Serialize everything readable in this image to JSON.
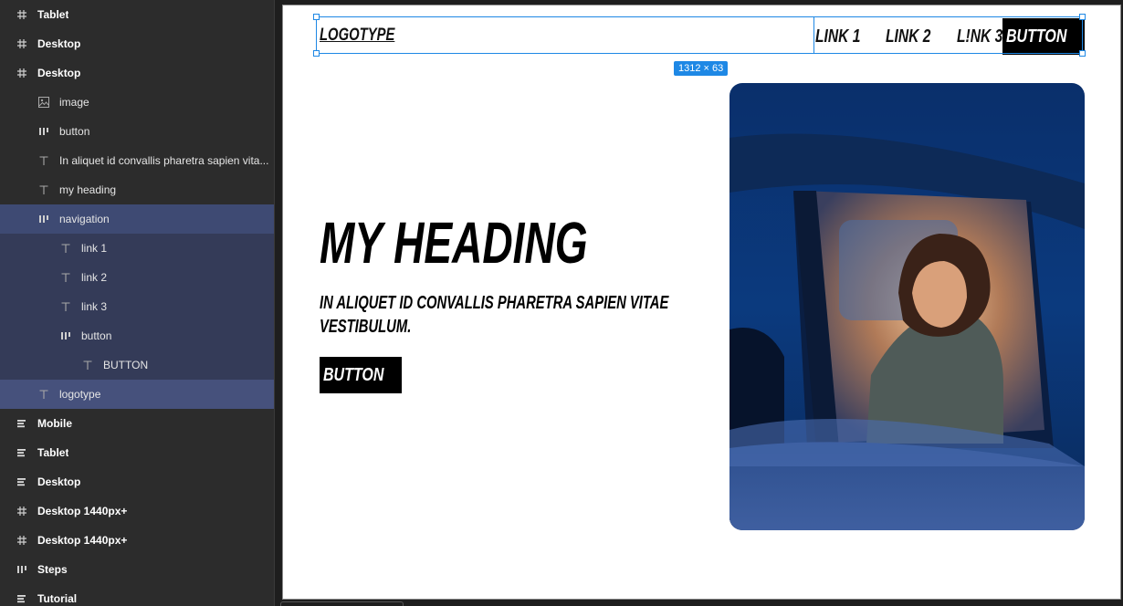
{
  "layers": [
    {
      "label": "Tablet",
      "icon": "frame-icon",
      "depth": 0,
      "bold": true,
      "state": ""
    },
    {
      "label": "Desktop",
      "icon": "frame-icon",
      "depth": 0,
      "bold": true,
      "state": ""
    },
    {
      "label": "Desktop",
      "icon": "frame-icon",
      "depth": 0,
      "bold": true,
      "state": ""
    },
    {
      "label": "image",
      "icon": "image-icon",
      "depth": 1,
      "bold": false,
      "state": ""
    },
    {
      "label": "button",
      "icon": "auto-layout-icon",
      "depth": 1,
      "bold": false,
      "state": ""
    },
    {
      "label": "In aliquet id convallis pharetra sapien vita...",
      "icon": "text-icon",
      "depth": 1,
      "bold": false,
      "state": ""
    },
    {
      "label": "my heading",
      "icon": "text-icon",
      "depth": 1,
      "bold": false,
      "state": ""
    },
    {
      "label": "navigation",
      "icon": "auto-layout-icon",
      "depth": 1,
      "bold": false,
      "state": "sel-parent"
    },
    {
      "label": "link 1",
      "icon": "text-icon",
      "depth": 2,
      "bold": false,
      "state": "sel-child"
    },
    {
      "label": "link 2",
      "icon": "text-icon",
      "depth": 2,
      "bold": false,
      "state": "sel-child"
    },
    {
      "label": "link 3",
      "icon": "text-icon",
      "depth": 2,
      "bold": false,
      "state": "sel-child"
    },
    {
      "label": "button",
      "icon": "auto-layout-icon",
      "depth": 2,
      "bold": false,
      "state": "sel-child"
    },
    {
      "label": "BUTTON",
      "icon": "text-icon",
      "depth": 3,
      "bold": false,
      "state": "sel-child"
    },
    {
      "label": "logotype",
      "icon": "text-icon",
      "depth": 1,
      "bold": false,
      "state": "sel-direct"
    },
    {
      "label": "Mobile",
      "icon": "list-icon",
      "depth": 0,
      "bold": true,
      "state": ""
    },
    {
      "label": "Tablet",
      "icon": "list-icon",
      "depth": 0,
      "bold": true,
      "state": ""
    },
    {
      "label": "Desktop",
      "icon": "list-icon",
      "depth": 0,
      "bold": true,
      "state": ""
    },
    {
      "label": "Desktop 1440px+",
      "icon": "frame-icon",
      "depth": 0,
      "bold": true,
      "state": ""
    },
    {
      "label": "Desktop 1440px+",
      "icon": "frame-icon",
      "depth": 0,
      "bold": true,
      "state": ""
    },
    {
      "label": "Steps",
      "icon": "auto-layout-icon",
      "depth": 0,
      "bold": true,
      "state": ""
    },
    {
      "label": "Tutorial",
      "icon": "list-icon",
      "depth": 0,
      "bold": true,
      "state": ""
    }
  ],
  "canvas": {
    "logotype": "LOGOTYPE",
    "nav_links": [
      "LINK 1",
      "LINK 2",
      "L!NK 3"
    ],
    "nav_button": "BUTTON",
    "selection_size": "1312 × 63",
    "heading": "MY HEADING",
    "subheading": "IN ALIQUET ID CONVALLIS PHARETRA SAPIEN VITAE VESTIBULUM.",
    "hero_button": "BUTTON",
    "hero_image": "car-window-portrait-image"
  },
  "colors": {
    "panel_bg": "#2c2c2c",
    "selected_parent": "#3e4a73",
    "selected_child": "#343b58",
    "selection_blue": "#1e88e5",
    "button_black": "#000000"
  }
}
